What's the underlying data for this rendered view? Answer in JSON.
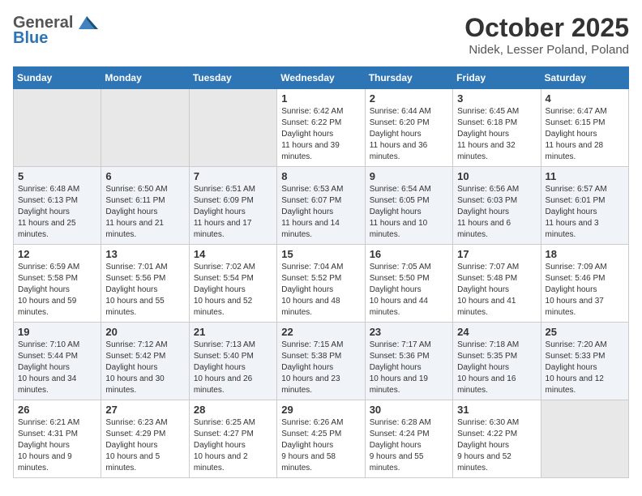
{
  "header": {
    "logo_general": "General",
    "logo_blue": "Blue",
    "month": "October 2025",
    "location": "Nidek, Lesser Poland, Poland"
  },
  "weekdays": [
    "Sunday",
    "Monday",
    "Tuesday",
    "Wednesday",
    "Thursday",
    "Friday",
    "Saturday"
  ],
  "weeks": [
    [
      {
        "day": "",
        "empty": true
      },
      {
        "day": "",
        "empty": true
      },
      {
        "day": "",
        "empty": true
      },
      {
        "day": "1",
        "sunrise": "6:42 AM",
        "sunset": "6:22 PM",
        "daylight": "11 hours and 39 minutes."
      },
      {
        "day": "2",
        "sunrise": "6:44 AM",
        "sunset": "6:20 PM",
        "daylight": "11 hours and 36 minutes."
      },
      {
        "day": "3",
        "sunrise": "6:45 AM",
        "sunset": "6:18 PM",
        "daylight": "11 hours and 32 minutes."
      },
      {
        "day": "4",
        "sunrise": "6:47 AM",
        "sunset": "6:15 PM",
        "daylight": "11 hours and 28 minutes."
      }
    ],
    [
      {
        "day": "5",
        "sunrise": "6:48 AM",
        "sunset": "6:13 PM",
        "daylight": "11 hours and 25 minutes."
      },
      {
        "day": "6",
        "sunrise": "6:50 AM",
        "sunset": "6:11 PM",
        "daylight": "11 hours and 21 minutes."
      },
      {
        "day": "7",
        "sunrise": "6:51 AM",
        "sunset": "6:09 PM",
        "daylight": "11 hours and 17 minutes."
      },
      {
        "day": "8",
        "sunrise": "6:53 AM",
        "sunset": "6:07 PM",
        "daylight": "11 hours and 14 minutes."
      },
      {
        "day": "9",
        "sunrise": "6:54 AM",
        "sunset": "6:05 PM",
        "daylight": "11 hours and 10 minutes."
      },
      {
        "day": "10",
        "sunrise": "6:56 AM",
        "sunset": "6:03 PM",
        "daylight": "11 hours and 6 minutes."
      },
      {
        "day": "11",
        "sunrise": "6:57 AM",
        "sunset": "6:01 PM",
        "daylight": "11 hours and 3 minutes."
      }
    ],
    [
      {
        "day": "12",
        "sunrise": "6:59 AM",
        "sunset": "5:58 PM",
        "daylight": "10 hours and 59 minutes."
      },
      {
        "day": "13",
        "sunrise": "7:01 AM",
        "sunset": "5:56 PM",
        "daylight": "10 hours and 55 minutes."
      },
      {
        "day": "14",
        "sunrise": "7:02 AM",
        "sunset": "5:54 PM",
        "daylight": "10 hours and 52 minutes."
      },
      {
        "day": "15",
        "sunrise": "7:04 AM",
        "sunset": "5:52 PM",
        "daylight": "10 hours and 48 minutes."
      },
      {
        "day": "16",
        "sunrise": "7:05 AM",
        "sunset": "5:50 PM",
        "daylight": "10 hours and 44 minutes."
      },
      {
        "day": "17",
        "sunrise": "7:07 AM",
        "sunset": "5:48 PM",
        "daylight": "10 hours and 41 minutes."
      },
      {
        "day": "18",
        "sunrise": "7:09 AM",
        "sunset": "5:46 PM",
        "daylight": "10 hours and 37 minutes."
      }
    ],
    [
      {
        "day": "19",
        "sunrise": "7:10 AM",
        "sunset": "5:44 PM",
        "daylight": "10 hours and 34 minutes."
      },
      {
        "day": "20",
        "sunrise": "7:12 AM",
        "sunset": "5:42 PM",
        "daylight": "10 hours and 30 minutes."
      },
      {
        "day": "21",
        "sunrise": "7:13 AM",
        "sunset": "5:40 PM",
        "daylight": "10 hours and 26 minutes."
      },
      {
        "day": "22",
        "sunrise": "7:15 AM",
        "sunset": "5:38 PM",
        "daylight": "10 hours and 23 minutes."
      },
      {
        "day": "23",
        "sunrise": "7:17 AM",
        "sunset": "5:36 PM",
        "daylight": "10 hours and 19 minutes."
      },
      {
        "day": "24",
        "sunrise": "7:18 AM",
        "sunset": "5:35 PM",
        "daylight": "10 hours and 16 minutes."
      },
      {
        "day": "25",
        "sunrise": "7:20 AM",
        "sunset": "5:33 PM",
        "daylight": "10 hours and 12 minutes."
      }
    ],
    [
      {
        "day": "26",
        "sunrise": "6:21 AM",
        "sunset": "4:31 PM",
        "daylight": "10 hours and 9 minutes."
      },
      {
        "day": "27",
        "sunrise": "6:23 AM",
        "sunset": "4:29 PM",
        "daylight": "10 hours and 5 minutes."
      },
      {
        "day": "28",
        "sunrise": "6:25 AM",
        "sunset": "4:27 PM",
        "daylight": "10 hours and 2 minutes."
      },
      {
        "day": "29",
        "sunrise": "6:26 AM",
        "sunset": "4:25 PM",
        "daylight": "9 hours and 58 minutes."
      },
      {
        "day": "30",
        "sunrise": "6:28 AM",
        "sunset": "4:24 PM",
        "daylight": "9 hours and 55 minutes."
      },
      {
        "day": "31",
        "sunrise": "6:30 AM",
        "sunset": "4:22 PM",
        "daylight": "9 hours and 52 minutes."
      },
      {
        "day": "",
        "empty": true
      }
    ]
  ],
  "labels": {
    "sunrise": "Sunrise:",
    "sunset": "Sunset:",
    "daylight": "Daylight hours"
  }
}
